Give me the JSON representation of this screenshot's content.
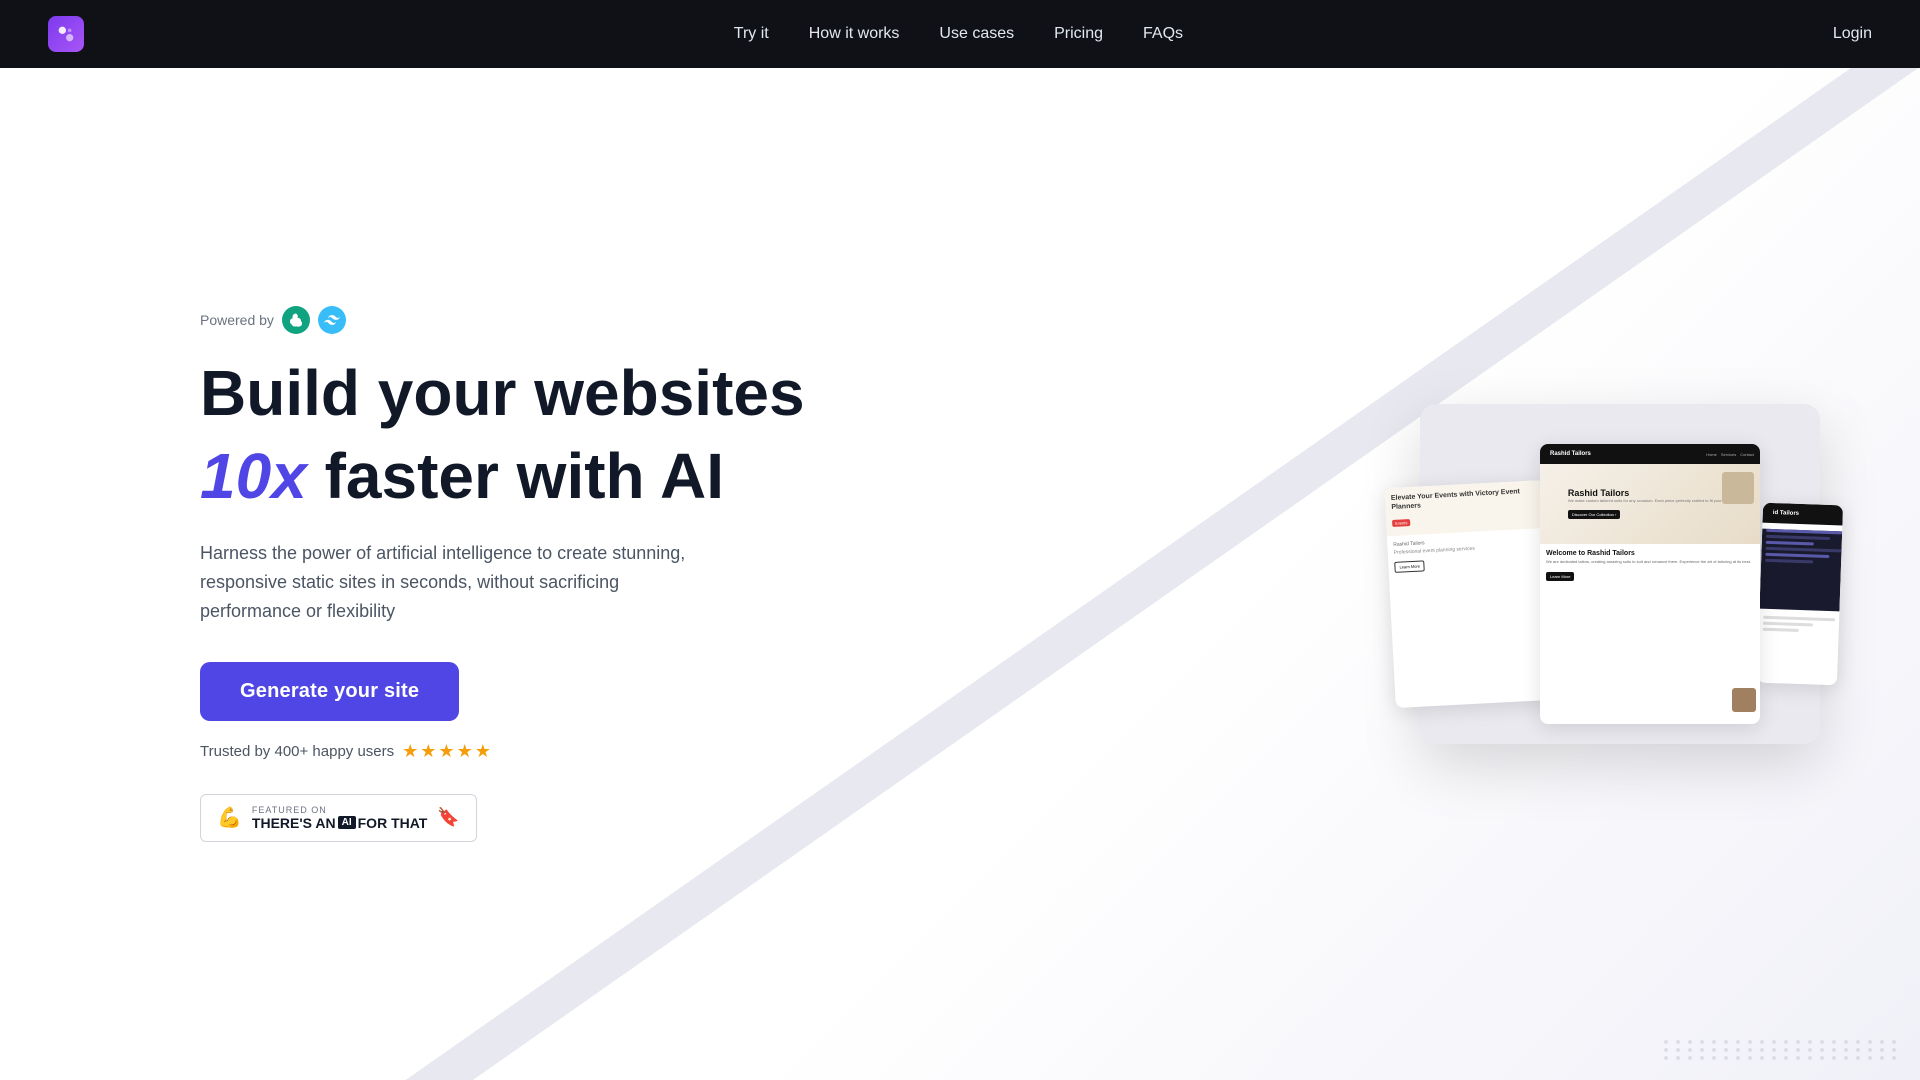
{
  "nav": {
    "logo_alt": "SiteForge AI",
    "links": [
      {
        "label": "Try it",
        "href": "#"
      },
      {
        "label": "How it works",
        "href": "#"
      },
      {
        "label": "Use cases",
        "href": "#"
      },
      {
        "label": "Pricing",
        "href": "#"
      },
      {
        "label": "FAQs",
        "href": "#"
      }
    ],
    "login_label": "Login"
  },
  "hero": {
    "powered_by_text": "Powered by",
    "headline_line1": "Build your websites",
    "headline_highlight": "10x",
    "headline_line2_rest": " faster with AI",
    "description": "Harness the power of artificial intelligence to create stunning, responsive static sites in seconds, without sacrificing performance or flexibility",
    "cta_label": "Generate your site",
    "trust_text": "Trusted by 400+ happy users",
    "stars": "★★★★★",
    "badge_label": "FEATURED ON",
    "badge_title_before": "THERE'S AN",
    "badge_ai": "AI",
    "badge_title_after": " FOR THAT"
  },
  "mockup": {
    "card_main_brand": "Rashid Tailors",
    "card_main_nav_links": [
      "Home",
      "Services",
      "Contact"
    ],
    "card_main_tagline": "Rashid Tailors",
    "card_main_sub": "We make custom tailored suits for any occasion. Each piece perfectly crafted to fit your style.",
    "card_main_btn": "Discover Our Collection ›",
    "card_main_section_title": "Welcome to Rashid Tailors",
    "card_main_section_text": "We are dedicated tailors, creating amazing suits to suit and romance them. Experience the art of tailoring at its best.",
    "card_main_section_btn": "Learn More",
    "card_left_title": "Elevate Your Events with Victory Event Planners",
    "card_left_badge": "Events",
    "card_left_brand": "Rashid Tailors",
    "card_right_brand": "id Tailors"
  }
}
